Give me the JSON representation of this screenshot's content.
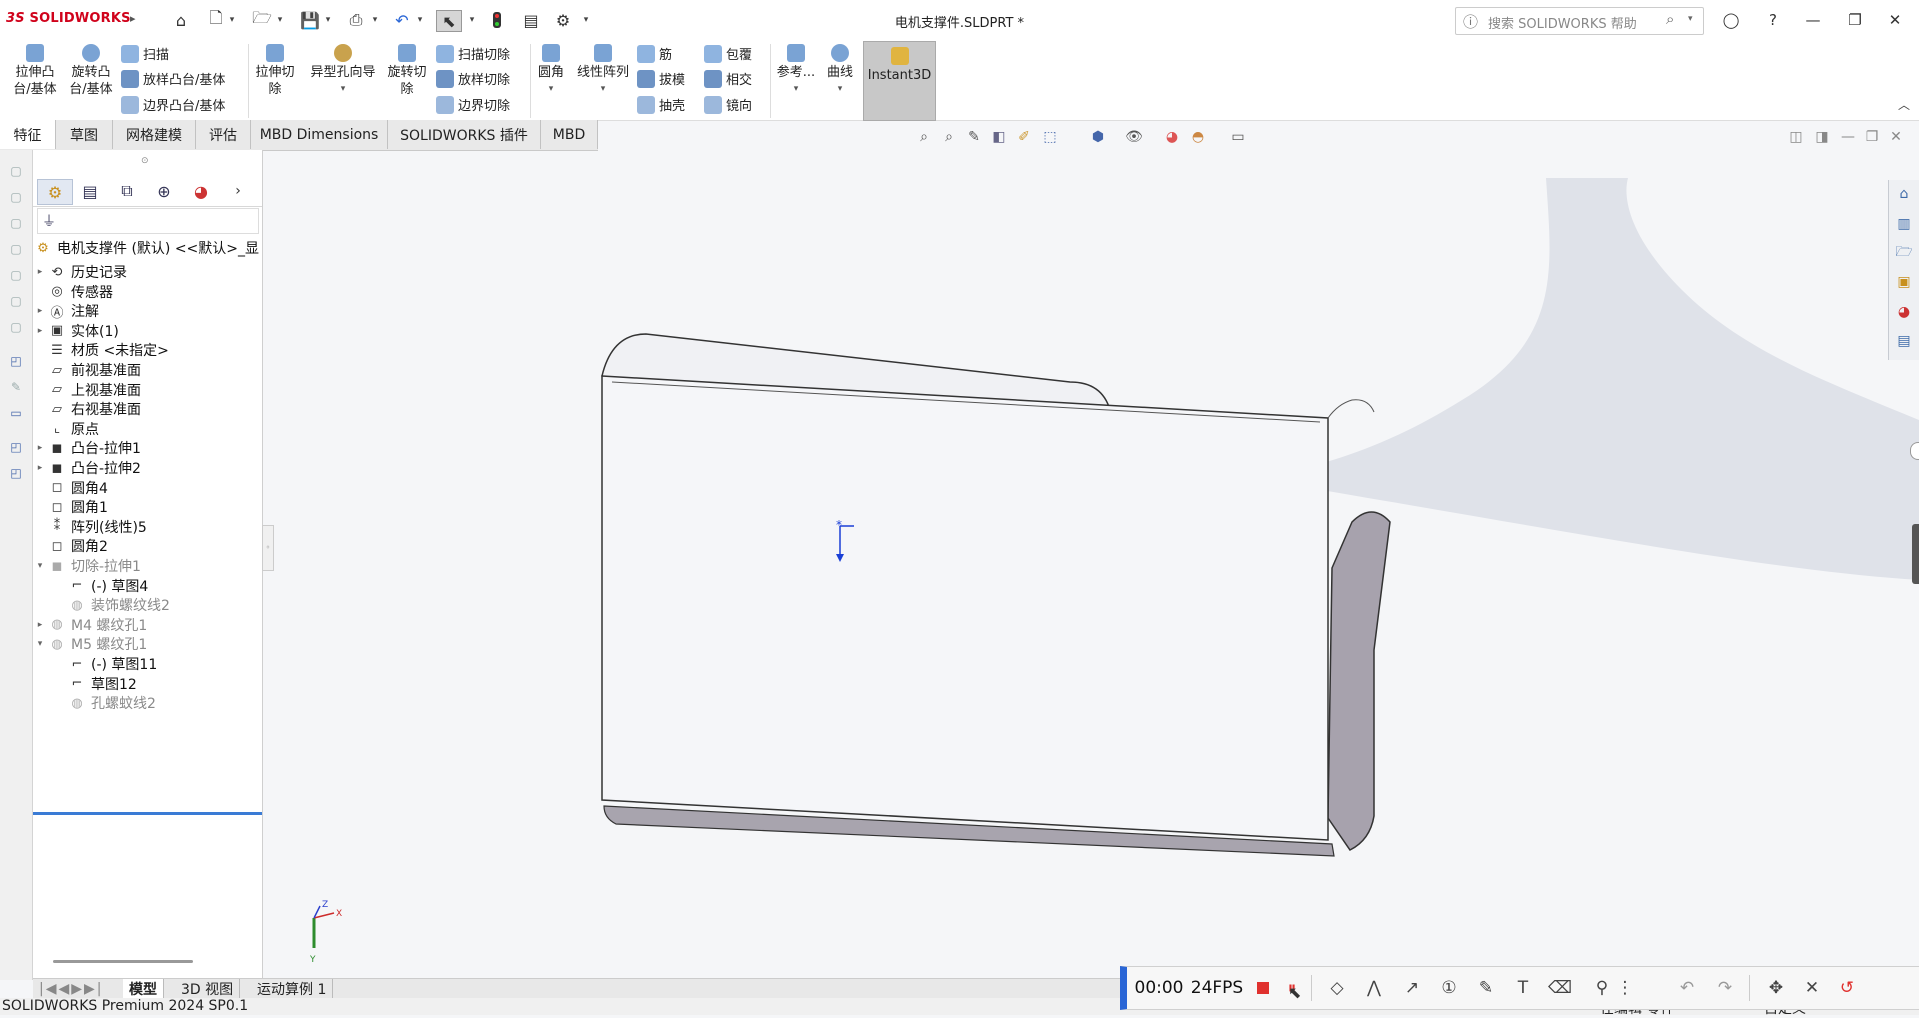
{
  "app": {
    "logo": "SOLIDWORKS",
    "document_title": "电机支撑件.SLDPRT *",
    "search_placeholder": "搜索 SOLIDWORKS 帮助"
  },
  "quick_access": {
    "icons": [
      "home-icon",
      "new-document-icon",
      "open-icon",
      "save-icon",
      "print-icon",
      "undo-icon",
      "select-icon",
      "traffic-light-icon",
      "file-properties-icon",
      "gear-icon"
    ]
  },
  "ribbon": {
    "extrude_boss": "拉伸凸\n台/基体",
    "revolve_boss": "旋转凸\n台/基体",
    "sweep": "扫描",
    "loft_boss": "放样凸台/基体",
    "boundary_boss": "边界凸台/基体",
    "extrude_cut": "拉伸切\n除",
    "hole_wizard": "异型孔向导",
    "revolve_cut": "旋转切\n除",
    "sweep_cut": "扫描切除",
    "loft_cut": "放样切除",
    "boundary_cut": "边界切除",
    "fillet": "圆角",
    "linear_pattern": "线性阵列",
    "rib": "筋",
    "draft": "拔模",
    "shell": "抽壳",
    "wrap": "包覆",
    "intersect": "相交",
    "mirror": "镜向",
    "reference": "参考...",
    "curves": "曲线",
    "instant3d": "Instant3D"
  },
  "tabs": [
    "特征",
    "草图",
    "网格建模",
    "评估",
    "MBD Dimensions",
    "SOLIDWORKS 插件",
    "MBD"
  ],
  "feature_tree": {
    "root": "电机支撑件 (默认) <<默认>_显",
    "items": [
      {
        "label": "历史记录",
        "expand": true,
        "dim": false,
        "indent": 0,
        "icon": "history-icon"
      },
      {
        "label": "传感器",
        "expand": false,
        "dim": false,
        "indent": 0,
        "icon": "sensor-icon"
      },
      {
        "label": "注解",
        "expand": true,
        "dim": false,
        "indent": 0,
        "icon": "annotation-icon"
      },
      {
        "label": "实体(1)",
        "expand": true,
        "dim": false,
        "indent": 0,
        "icon": "solid-body-icon"
      },
      {
        "label": "材质 <未指定>",
        "expand": false,
        "dim": false,
        "indent": 0,
        "icon": "material-icon"
      },
      {
        "label": "前视基准面",
        "expand": false,
        "dim": false,
        "indent": 0,
        "icon": "plane-icon"
      },
      {
        "label": "上视基准面",
        "expand": false,
        "dim": false,
        "indent": 0,
        "icon": "plane-icon"
      },
      {
        "label": "右视基准面",
        "expand": false,
        "dim": false,
        "indent": 0,
        "icon": "plane-icon"
      },
      {
        "label": "原点",
        "expand": false,
        "dim": false,
        "indent": 0,
        "icon": "origin-icon"
      },
      {
        "label": "凸台-拉伸1",
        "expand": true,
        "dim": false,
        "indent": 0,
        "icon": "extrude-icon"
      },
      {
        "label": "凸台-拉伸2",
        "expand": true,
        "dim": false,
        "indent": 0,
        "icon": "extrude-icon"
      },
      {
        "label": "圆角4",
        "expand": false,
        "dim": false,
        "indent": 0,
        "icon": "fillet-icon"
      },
      {
        "label": "圆角1",
        "expand": false,
        "dim": false,
        "indent": 0,
        "icon": "fillet-icon"
      },
      {
        "label": "阵列(线性)5",
        "expand": false,
        "dim": false,
        "indent": 0,
        "icon": "pattern-icon"
      },
      {
        "label": "圆角2",
        "expand": false,
        "dim": false,
        "indent": 0,
        "icon": "fillet-icon"
      },
      {
        "label": "切除-拉伸1",
        "expand": "open",
        "dim": true,
        "indent": 0,
        "icon": "cut-icon"
      },
      {
        "label": "(-) 草图4",
        "expand": false,
        "dim": false,
        "indent": 1,
        "icon": "sketch-icon"
      },
      {
        "label": "装饰螺纹线2",
        "expand": false,
        "dim": true,
        "indent": 1,
        "icon": "thread-icon"
      },
      {
        "label": "M4 螺纹孔1",
        "expand": true,
        "dim": true,
        "indent": 0,
        "icon": "hole-icon"
      },
      {
        "label": "M5 螺纹孔1",
        "expand": "open",
        "dim": true,
        "indent": 0,
        "icon": "hole-icon"
      },
      {
        "label": "(-) 草图11",
        "expand": false,
        "dim": false,
        "indent": 1,
        "icon": "sketch-icon"
      },
      {
        "label": "草图12",
        "expand": false,
        "dim": false,
        "indent": 1,
        "icon": "sketch-icon"
      },
      {
        "label": "孔螺蚊线2",
        "expand": false,
        "dim": true,
        "indent": 1,
        "icon": "thread-icon"
      }
    ]
  },
  "bottom_tabs": [
    "模型",
    "3D 视图",
    "运动算例 1"
  ],
  "status": {
    "left": "SOLIDWORKS Premium 2024 SP0.1",
    "right1": "在编辑 零件",
    "right2": "自定义"
  },
  "recorder": {
    "time": "00:00",
    "fps": "24FPS"
  },
  "triad": {
    "z": "Z",
    "x": "X",
    "y": "Y"
  },
  "colors": {
    "accent": "#2a66d6",
    "record": "#e0312e",
    "logo": "#d0021b"
  }
}
